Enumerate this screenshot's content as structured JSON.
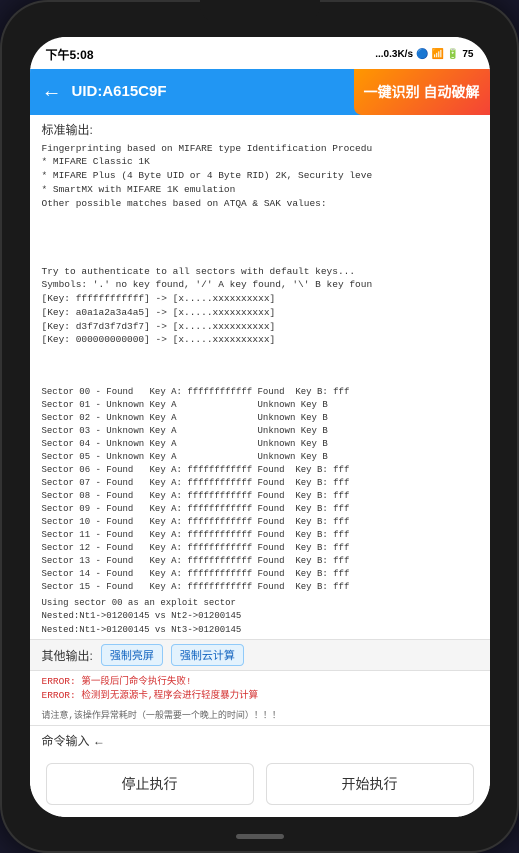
{
  "phone": {
    "status_bar": {
      "time": "下午5:08",
      "network": "...0.3K/s",
      "bluetooth_icon": "bluetooth",
      "signal_icon": "signal",
      "wifi_icon": "wifi",
      "battery": "75"
    },
    "header": {
      "back_icon": "←",
      "title": "UID:A615C9F",
      "badge": "一键识别 自动破解"
    },
    "standard_output_label": "标准输出:",
    "fingerprint_text": "Fingerprinting based on MIFARE type Identification Procedu\n* MIFARE Classic 1K\n* MIFARE Plus (4 Byte UID or 4 Byte RID) 2K, Security leve\n* SmartMX with MIFARE 1K emulation\nOther possible matches based on ATQA & SAK values:",
    "auth_text": "Try to authenticate to all sectors with default keys...\nSymbols: '.' no key found, '/' A key found, '\\' B key foun\n[Key: ffffffffffff] -> [x.....xxxxxxxxxx]\n[Key: a0a1a2a3a4a5] -> [x.....xxxxxxxxxx]\n[Key: d3f7d3f7d3f7] -> [x.....xxxxxxxxxx]\n[Key: 000000000000] -> [x.....xxxxxxxxxx]",
    "sectors": [
      {
        "num": "00",
        "status_a": "Found  ",
        "key_a": "ffffffffffff",
        "found_b": "Found",
        "key_b": "fff"
      },
      {
        "num": "01",
        "status_a": "Unknown Key A",
        "key_a": "",
        "found_b": "Unknown Key B",
        "key_b": ""
      },
      {
        "num": "02",
        "status_a": "Unknown Key A",
        "key_a": "",
        "found_b": "Unknown Key B",
        "key_b": ""
      },
      {
        "num": "03",
        "status_a": "Unknown Key A",
        "key_a": "",
        "found_b": "Unknown Key B",
        "key_b": ""
      },
      {
        "num": "04",
        "status_a": "Unknown Key A",
        "key_a": "",
        "found_b": "Unknown Key B",
        "key_b": ""
      },
      {
        "num": "05",
        "status_a": "Unknown Key A",
        "key_a": "",
        "found_b": "Unknown Key B",
        "key_b": ""
      },
      {
        "num": "06",
        "status_a": "Found  ",
        "key_a": "ffffffffffff",
        "found_b": "Found",
        "key_b": "fff"
      },
      {
        "num": "07",
        "status_a": "Found  ",
        "key_a": "ffffffffffff",
        "found_b": "Found",
        "key_b": "fff"
      },
      {
        "num": "08",
        "status_a": "Found  ",
        "key_a": "ffffffffffff",
        "found_b": "Found",
        "key_b": "fff"
      },
      {
        "num": "09",
        "status_a": "Found  ",
        "key_a": "ffffffffffff",
        "found_b": "Found",
        "key_b": "fff"
      },
      {
        "num": "10",
        "status_a": "Found  ",
        "key_a": "ffffffffffff",
        "found_b": "Found",
        "key_b": "fff"
      },
      {
        "num": "11",
        "status_a": "Found  ",
        "key_a": "ffffffffffff",
        "found_b": "Found",
        "key_b": "fff"
      },
      {
        "num": "12",
        "status_a": "Found  ",
        "key_a": "ffffffffffff",
        "found_b": "Found",
        "key_b": "fff"
      },
      {
        "num": "13",
        "status_a": "Found  ",
        "key_a": "ffffffffffff",
        "found_b": "Found",
        "key_b": "fff"
      },
      {
        "num": "14",
        "status_a": "Found  ",
        "key_a": "ffffffffffff",
        "found_b": "Found",
        "key_b": "fff"
      },
      {
        "num": "15",
        "status_a": "Found  ",
        "key_a": "ffffffffffff",
        "found_b": "Found",
        "key_b": "fff"
      }
    ],
    "using_sector_text": "Using sector 00 as an exploit sector\nNested:Nt1->01200145 vs Nt2->01200145\nNested:Nt1->01200145 vs Nt3->01200145",
    "other_output_label": "其他输出:",
    "btn_force_bright": "强制亮屏",
    "btn_force_cloud": "强制云计算",
    "error_lines": [
      "ERROR:  第一段后门命令执行失败!",
      "ERROR:  检测到无源源卡,程序会进行轻度暴力计算",
      "请注意,该操作异常耗时（一般需要一个晚上的时间）！！！"
    ],
    "command_label": "命令输入 ←",
    "btn_stop": "停止执行",
    "btn_start": "开始执行"
  }
}
